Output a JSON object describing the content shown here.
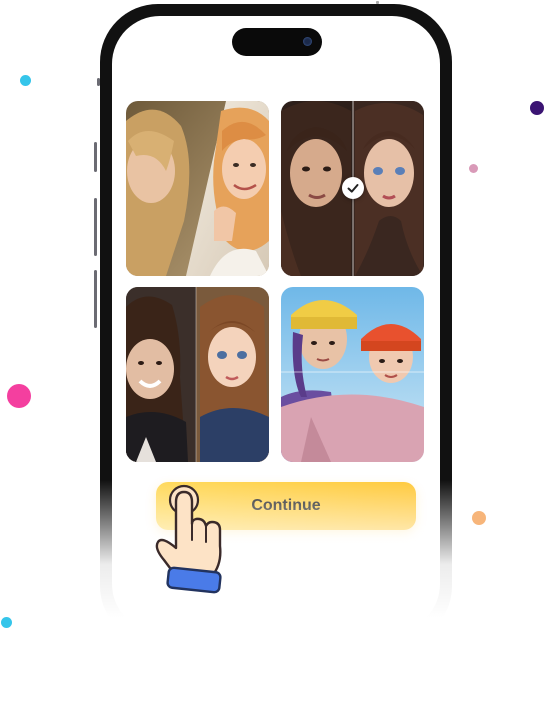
{
  "colors": {
    "accent": "#ffc93c",
    "phone_frame": "#111111",
    "dot_pink": "#f43f9f",
    "dot_cyan": "#35c5ea",
    "dot_purple": "#3b1473",
    "dot_orange": "#f7b57a"
  },
  "gallery": {
    "tiles": [
      {
        "name": "before-after-blonde",
        "selected": false
      },
      {
        "name": "before-after-brunette",
        "selected": true
      },
      {
        "name": "before-after-smiling",
        "selected": false
      },
      {
        "name": "before-after-beanies",
        "selected": false
      }
    ]
  },
  "continue_button": {
    "label": "Continue"
  },
  "icons": {
    "check": "check-icon",
    "pointer": "pointing-hand-icon"
  }
}
